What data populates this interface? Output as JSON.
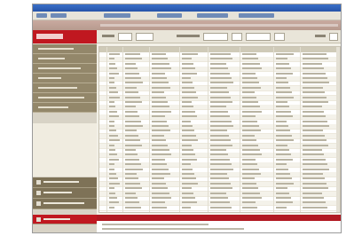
{
  "colors": {
    "titlebar": "#2653a8",
    "brand_red": "#c01820",
    "sidebar_item": "#93876a",
    "sidebar_lower": "#7e7257",
    "status_bar": "#b11a22"
  },
  "window": {
    "title": ""
  },
  "toolbar": {
    "buttons": [
      "",
      "",
      "",
      "",
      "",
      ""
    ]
  },
  "sidebar": {
    "logo_icon": "brand-logo",
    "items": [
      "",
      "",
      "",
      "",
      "",
      "",
      ""
    ],
    "lower_items": [
      "",
      "",
      "",
      ""
    ]
  },
  "grid": {
    "row_count": 33
  }
}
